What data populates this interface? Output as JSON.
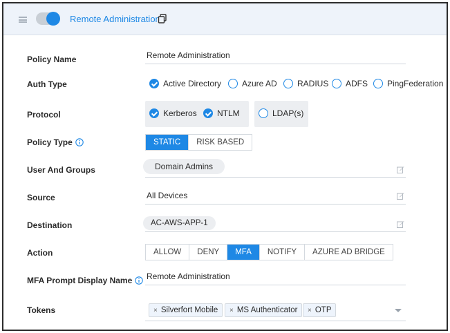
{
  "header": {
    "title": "Remote Administration",
    "toggle_on": true,
    "accent": "#1e88e5"
  },
  "labels": {
    "policy_name": "Policy Name",
    "auth_type": "Auth Type",
    "protocol": "Protocol",
    "policy_type": "Policy Type",
    "users_groups": "User And Groups",
    "source": "Source",
    "destination": "Destination",
    "action": "Action",
    "mfa_prompt": "MFA Prompt Display Name",
    "tokens": "Tokens"
  },
  "policy_name": {
    "value": "Remote Administration"
  },
  "auth_type": {
    "options": [
      "Active Directory",
      "Azure AD",
      "RADIUS",
      "ADFS",
      "PingFederation"
    ],
    "selected": "Active Directory"
  },
  "protocol": {
    "options": [
      "Kerberos",
      "NTLM",
      "LDAP(s)"
    ],
    "checked": [
      "Kerberos",
      "NTLM"
    ]
  },
  "policy_type": {
    "options": [
      "STATIC",
      "RISK BASED"
    ],
    "selected": "STATIC"
  },
  "users_groups": {
    "items": [
      "Domain Admins"
    ]
  },
  "source": {
    "value": "All Devices"
  },
  "destination": {
    "items": [
      "AC-AWS-APP-1"
    ]
  },
  "action": {
    "options": [
      "ALLOW",
      "DENY",
      "MFA",
      "NOTIFY",
      "AZURE AD BRIDGE"
    ],
    "selected": "MFA"
  },
  "mfa_prompt": {
    "value": "Remote Administration"
  },
  "tokens": {
    "items": [
      "Silverfort Mobile",
      "MS Authenticator",
      "OTP"
    ],
    "remove_glyph": "×"
  },
  "icons": {
    "menu": "hamburger-icon",
    "copy": "copy-icon",
    "info": "info-icon",
    "edit": "edit-icon",
    "dropdown": "chevron-down-icon"
  }
}
